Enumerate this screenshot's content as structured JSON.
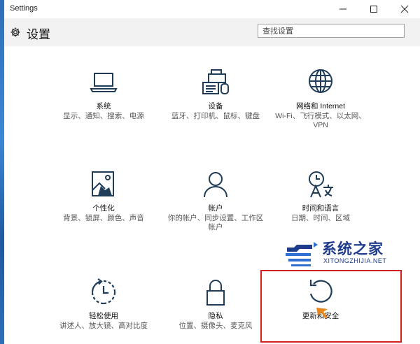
{
  "window": {
    "title": "Settings",
    "controls": [
      "minimize",
      "maximize",
      "close"
    ]
  },
  "header": {
    "title": "设置",
    "search_placeholder": "查找设置"
  },
  "tiles": [
    {
      "id": "system",
      "icon": "laptop-icon",
      "name": "系统",
      "desc": "显示、通知、搜索、电源"
    },
    {
      "id": "devices",
      "icon": "devices-icon",
      "name": "设备",
      "desc": "蓝牙、打印机、鼠标、键盘"
    },
    {
      "id": "network",
      "icon": "globe-icon",
      "name": "网络和 Internet",
      "desc": "Wi-Fi、飞行模式、以太网、VPN"
    },
    {
      "id": "personalization",
      "icon": "personalization-icon",
      "name": "个性化",
      "desc": "背景、锁屏、颜色、声音"
    },
    {
      "id": "accounts",
      "icon": "person-icon",
      "name": "帐户",
      "desc": "你的帐户、同步设置、工作区帐户"
    },
    {
      "id": "time-language",
      "icon": "time-language-icon",
      "name": "时间和语言",
      "desc": "日期、时间、区域"
    },
    {
      "id": "ease-of-access",
      "icon": "ease-of-access-icon",
      "name": "轻松使用",
      "desc": "讲述人、放大镜、高对比度"
    },
    {
      "id": "privacy",
      "icon": "lock-icon",
      "name": "隐私",
      "desc": "位置、摄像头、麦克风"
    },
    {
      "id": "update-security",
      "icon": "refresh-icon",
      "name": "更新和安全",
      "desc": ""
    }
  ],
  "watermark": {
    "title": "系统之家",
    "subtitle": "XITONGZHIJIA.NET"
  },
  "colors": {
    "accent": "#1f3c58",
    "header_bg": "#f2f2f2",
    "highlight": "#d32020",
    "watermark": "#1f3c8c"
  }
}
